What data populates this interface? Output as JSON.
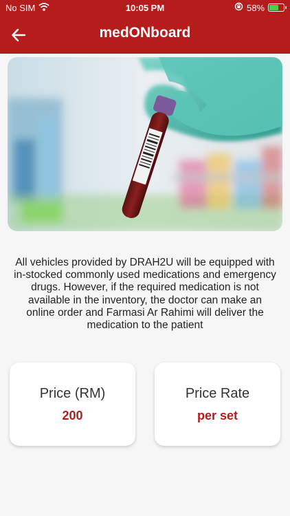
{
  "status_bar": {
    "carrier": "No SIM",
    "time": "10:05 PM",
    "battery_percent": "58%",
    "battery_level": 0.58,
    "wifi_icon": "wifi-icon",
    "orientation_lock_icon": "orientation-lock-icon"
  },
  "header": {
    "title": "medONboard",
    "back_icon": "arrow-left-icon",
    "background_color": "#b51d1d"
  },
  "hero": {
    "image": "gloved hand holding blood sample tube with barcode label, pharmacy shelves in background"
  },
  "description": "All vehicles provided by DRAH2U will be equipped with in-stocked commonly used medications and emergency drugs. However, if the required medication is not available in the inventory, the doctor can make an online order and Farmasi Ar Rahimi will deliver the medication to the patient",
  "cards": [
    {
      "label": "Price (RM)",
      "value": "200"
    },
    {
      "label": "Price Rate",
      "value": "per set"
    }
  ],
  "colors": {
    "accent": "#b51d1d",
    "background": "#f6f6f6"
  }
}
